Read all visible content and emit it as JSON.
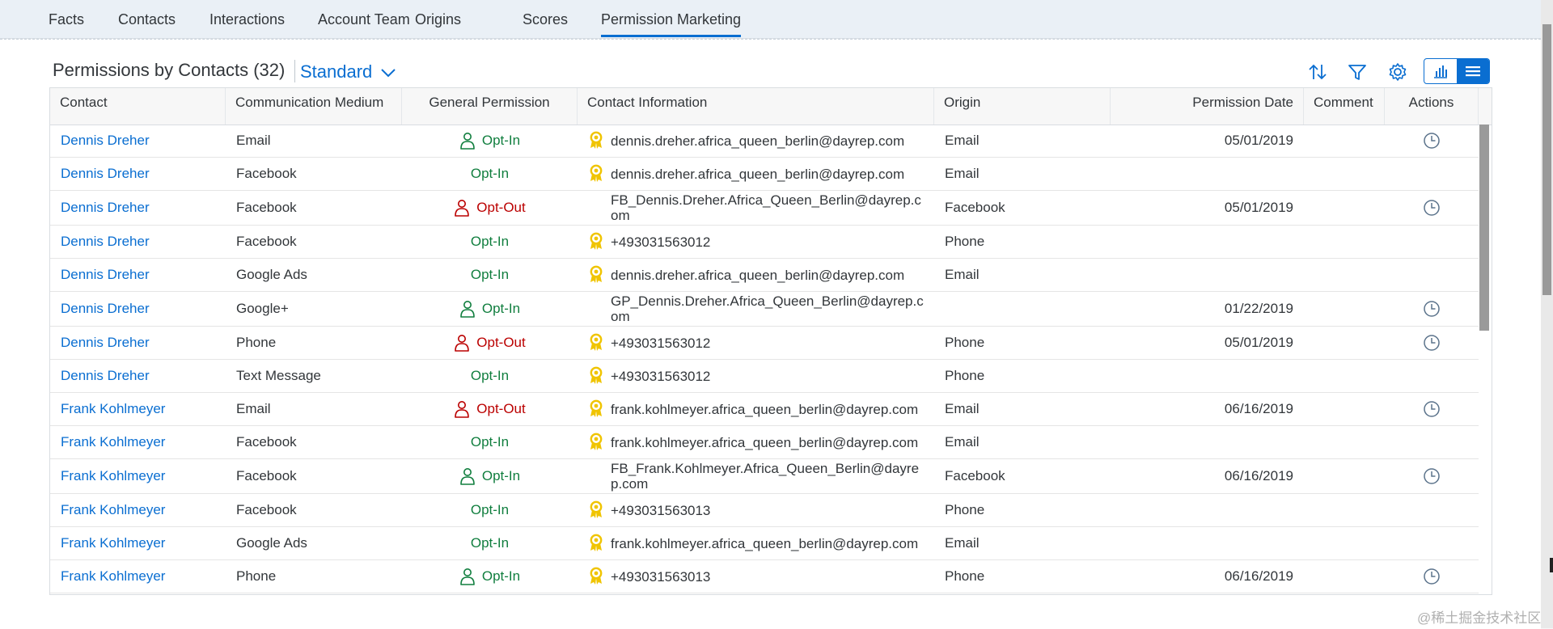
{
  "tabs": [
    "Facts",
    "Contacts",
    "Interactions",
    "Account Team",
    "Origins",
    "Scores",
    "Permission Marketing"
  ],
  "active_tab": "Permission Marketing",
  "table_title": "Permissions by Contacts (32)",
  "variant": "Standard",
  "columns": [
    "Contact",
    "Communication Medium",
    "General Permission",
    "Contact Information",
    "Origin",
    "Permission Date",
    "Comment",
    "Actions"
  ],
  "rows": [
    {
      "contact": "Dennis Dreher",
      "medium": "Email",
      "perm": "Opt-In",
      "person_icon": true,
      "award": true,
      "info": "dennis.dreher.africa_queen_berlin@dayrep.com",
      "origin": "Email",
      "date": "05/01/2019",
      "clock": true
    },
    {
      "contact": "Dennis Dreher",
      "medium": "Facebook",
      "perm": "Opt-In",
      "person_icon": false,
      "award": true,
      "info": "dennis.dreher.africa_queen_berlin@dayrep.com",
      "origin": "Email",
      "date": "",
      "clock": false
    },
    {
      "contact": "Dennis Dreher",
      "medium": "Facebook",
      "perm": "Opt-Out",
      "person_icon": true,
      "award": false,
      "info": "FB_Dennis.Dreher.Africa_Queen_Berlin@dayrep.com",
      "origin": "Facebook",
      "date": "05/01/2019",
      "clock": true
    },
    {
      "contact": "Dennis Dreher",
      "medium": "Facebook",
      "perm": "Opt-In",
      "person_icon": false,
      "award": true,
      "info": "+493031563012",
      "origin": "Phone",
      "date": "",
      "clock": false
    },
    {
      "contact": "Dennis Dreher",
      "medium": "Google Ads",
      "perm": "Opt-In",
      "person_icon": false,
      "award": true,
      "info": "dennis.dreher.africa_queen_berlin@dayrep.com",
      "origin": "Email",
      "date": "",
      "clock": false
    },
    {
      "contact": "Dennis Dreher",
      "medium": "Google+",
      "perm": "Opt-In",
      "person_icon": true,
      "award": false,
      "info": "GP_Dennis.Dreher.Africa_Queen_Berlin@dayrep.com",
      "origin": "",
      "date": "01/22/2019",
      "clock": true
    },
    {
      "contact": "Dennis Dreher",
      "medium": "Phone",
      "perm": "Opt-Out",
      "person_icon": true,
      "award": true,
      "info": "+493031563012",
      "origin": "Phone",
      "date": "05/01/2019",
      "clock": true
    },
    {
      "contact": "Dennis Dreher",
      "medium": "Text Message",
      "perm": "Opt-In",
      "person_icon": false,
      "award": true,
      "info": "+493031563012",
      "origin": "Phone",
      "date": "",
      "clock": false
    },
    {
      "contact": "Frank Kohlmeyer",
      "medium": "Email",
      "perm": "Opt-Out",
      "person_icon": true,
      "award": true,
      "info": "frank.kohlmeyer.africa_queen_berlin@dayrep.com",
      "origin": "Email",
      "date": "06/16/2019",
      "clock": true
    },
    {
      "contact": "Frank Kohlmeyer",
      "medium": "Facebook",
      "perm": "Opt-In",
      "person_icon": false,
      "award": true,
      "info": "frank.kohlmeyer.africa_queen_berlin@dayrep.com",
      "origin": "Email",
      "date": "",
      "clock": false
    },
    {
      "contact": "Frank Kohlmeyer",
      "medium": "Facebook",
      "perm": "Opt-In",
      "person_icon": true,
      "award": false,
      "info": "FB_Frank.Kohlmeyer.Africa_Queen_Berlin@dayrep.com",
      "origin": "Facebook",
      "date": "06/16/2019",
      "clock": true
    },
    {
      "contact": "Frank Kohlmeyer",
      "medium": "Facebook",
      "perm": "Opt-In",
      "person_icon": false,
      "award": true,
      "info": "+493031563013",
      "origin": "Phone",
      "date": "",
      "clock": false
    },
    {
      "contact": "Frank Kohlmeyer",
      "medium": "Google Ads",
      "perm": "Opt-In",
      "person_icon": false,
      "award": true,
      "info": "frank.kohlmeyer.africa_queen_berlin@dayrep.com",
      "origin": "Email",
      "date": "",
      "clock": false
    },
    {
      "contact": "Frank Kohlmeyer",
      "medium": "Phone",
      "perm": "Opt-In",
      "person_icon": true,
      "award": true,
      "info": "+493031563013",
      "origin": "Phone",
      "date": "06/16/2019",
      "clock": true
    }
  ],
  "colors": {
    "link": "#0a6ed1",
    "opt_in": "#107e3e",
    "opt_out": "#bb0000",
    "award": "#f0c400",
    "clock": "#5b738b"
  },
  "watermark": "@稀土掘金技术社区"
}
